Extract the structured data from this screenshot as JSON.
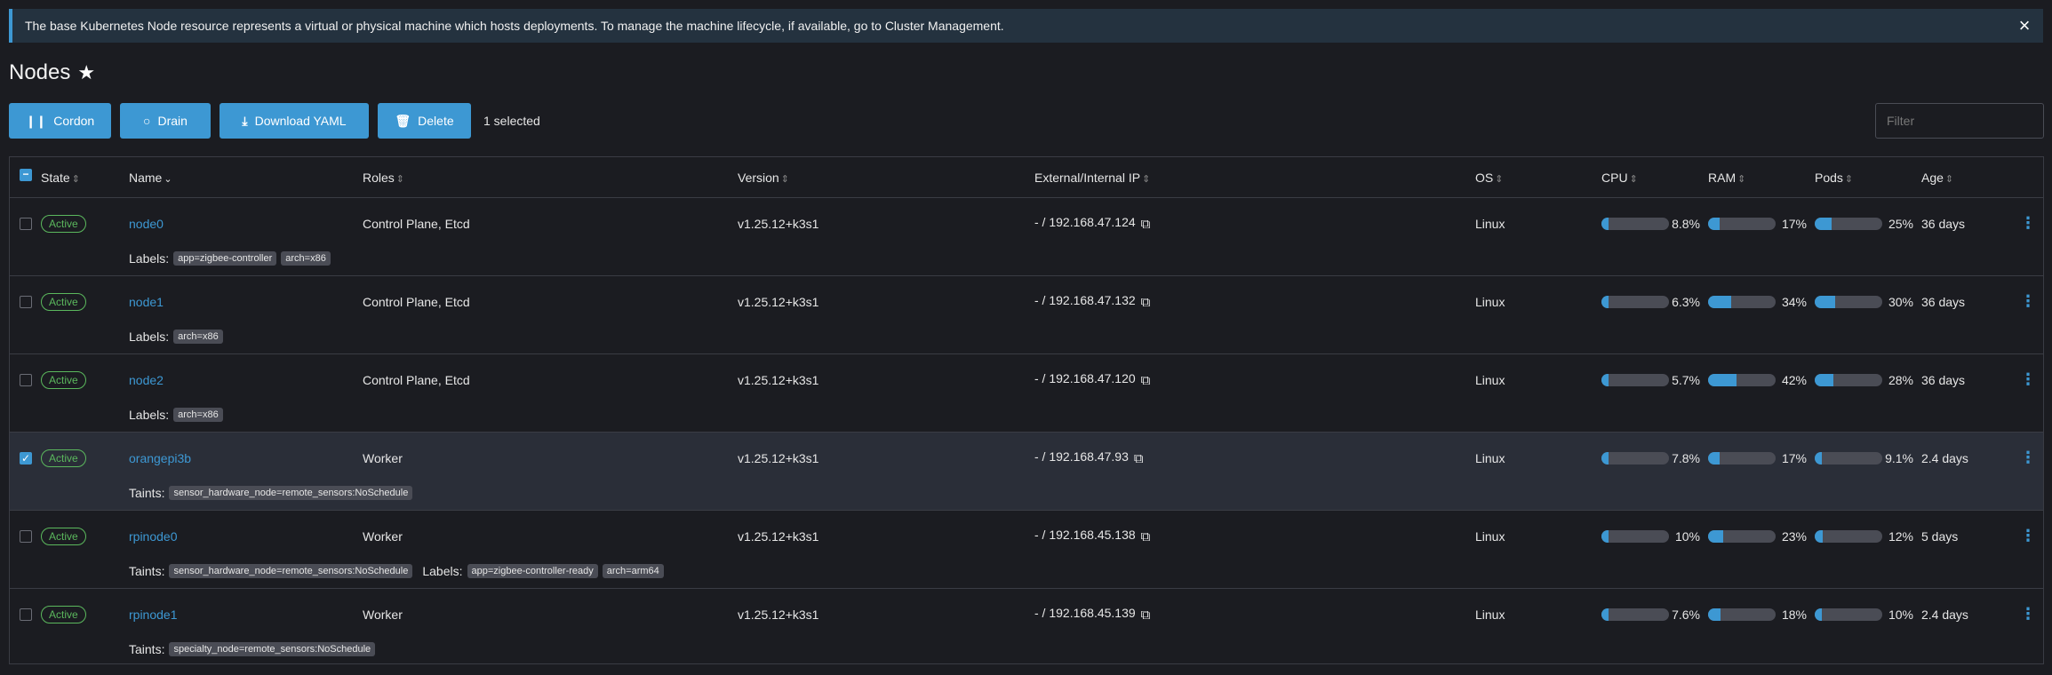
{
  "banner": {
    "text": "The base Kubernetes Node resource represents a virtual or physical machine which hosts deployments. To manage the machine lifecycle, if available, go to Cluster Management.",
    "close_icon": "close-icon"
  },
  "page": {
    "title": "Nodes",
    "star_icon": "star-icon"
  },
  "toolbar": {
    "cordon": "Cordon",
    "drain": "Drain",
    "download": "Download YAML",
    "delete": "Delete",
    "selected": "1 selected",
    "filter_placeholder": "Filter"
  },
  "columns": {
    "state": "State",
    "name": "Name",
    "roles": "Roles",
    "version": "Version",
    "ip": "External/Internal IP",
    "os": "OS",
    "cpu": "CPU",
    "ram": "RAM",
    "pods": "Pods",
    "age": "Age"
  },
  "labels_prefix": "Labels:",
  "taints_prefix": "Taints:",
  "rows": [
    {
      "state": "Active",
      "name": "node0",
      "roles": "Control Plane, Etcd",
      "version": "v1.25.12+k3s1",
      "ip": "- / 192.168.47.124",
      "os": "Linux",
      "cpu": "8.8%",
      "ram": "17%",
      "pods": "25%",
      "age": "36 days",
      "cpu_frac": 0.088,
      "ram_frac": 0.17,
      "pods_frac": 0.25,
      "selected": false,
      "taints": [],
      "labels": [
        "app=zigbee-controller",
        "arch=x86"
      ]
    },
    {
      "state": "Active",
      "name": "node1",
      "roles": "Control Plane, Etcd",
      "version": "v1.25.12+k3s1",
      "ip": "- / 192.168.47.132",
      "os": "Linux",
      "cpu": "6.3%",
      "ram": "34%",
      "pods": "30%",
      "age": "36 days",
      "cpu_frac": 0.063,
      "ram_frac": 0.34,
      "pods_frac": 0.3,
      "selected": false,
      "taints": [],
      "labels": [
        "arch=x86"
      ]
    },
    {
      "state": "Active",
      "name": "node2",
      "roles": "Control Plane, Etcd",
      "version": "v1.25.12+k3s1",
      "ip": "- / 192.168.47.120",
      "os": "Linux",
      "cpu": "5.7%",
      "ram": "42%",
      "pods": "28%",
      "age": "36 days",
      "cpu_frac": 0.057,
      "ram_frac": 0.42,
      "pods_frac": 0.28,
      "selected": false,
      "taints": [],
      "labels": [
        "arch=x86"
      ]
    },
    {
      "state": "Active",
      "name": "orangepi3b",
      "roles": "Worker",
      "version": "v1.25.12+k3s1",
      "ip": "- / 192.168.47.93",
      "os": "Linux",
      "cpu": "7.8%",
      "ram": "17%",
      "pods": "9.1%",
      "age": "2.4 days",
      "cpu_frac": 0.078,
      "ram_frac": 0.17,
      "pods_frac": 0.091,
      "selected": true,
      "taints": [
        "sensor_hardware_node=remote_sensors:NoSchedule"
      ],
      "labels": []
    },
    {
      "state": "Active",
      "name": "rpinode0",
      "roles": "Worker",
      "version": "v1.25.12+k3s1",
      "ip": "- / 192.168.45.138",
      "os": "Linux",
      "cpu": "10%",
      "ram": "23%",
      "pods": "12%",
      "age": "5 days",
      "cpu_frac": 0.1,
      "ram_frac": 0.23,
      "pods_frac": 0.12,
      "selected": false,
      "taints": [
        "sensor_hardware_node=remote_sensors:NoSchedule"
      ],
      "labels": [
        "app=zigbee-controller-ready",
        "arch=arm64"
      ]
    },
    {
      "state": "Active",
      "name": "rpinode1",
      "roles": "Worker",
      "version": "v1.25.12+k3s1",
      "ip": "- / 192.168.45.139",
      "os": "Linux",
      "cpu": "7.6%",
      "ram": "18%",
      "pods": "10%",
      "age": "2.4 days",
      "cpu_frac": 0.076,
      "ram_frac": 0.18,
      "pods_frac": 0.1,
      "selected": false,
      "taints": [
        "specialty_node=remote_sensors:NoSchedule"
      ],
      "labels": []
    }
  ]
}
